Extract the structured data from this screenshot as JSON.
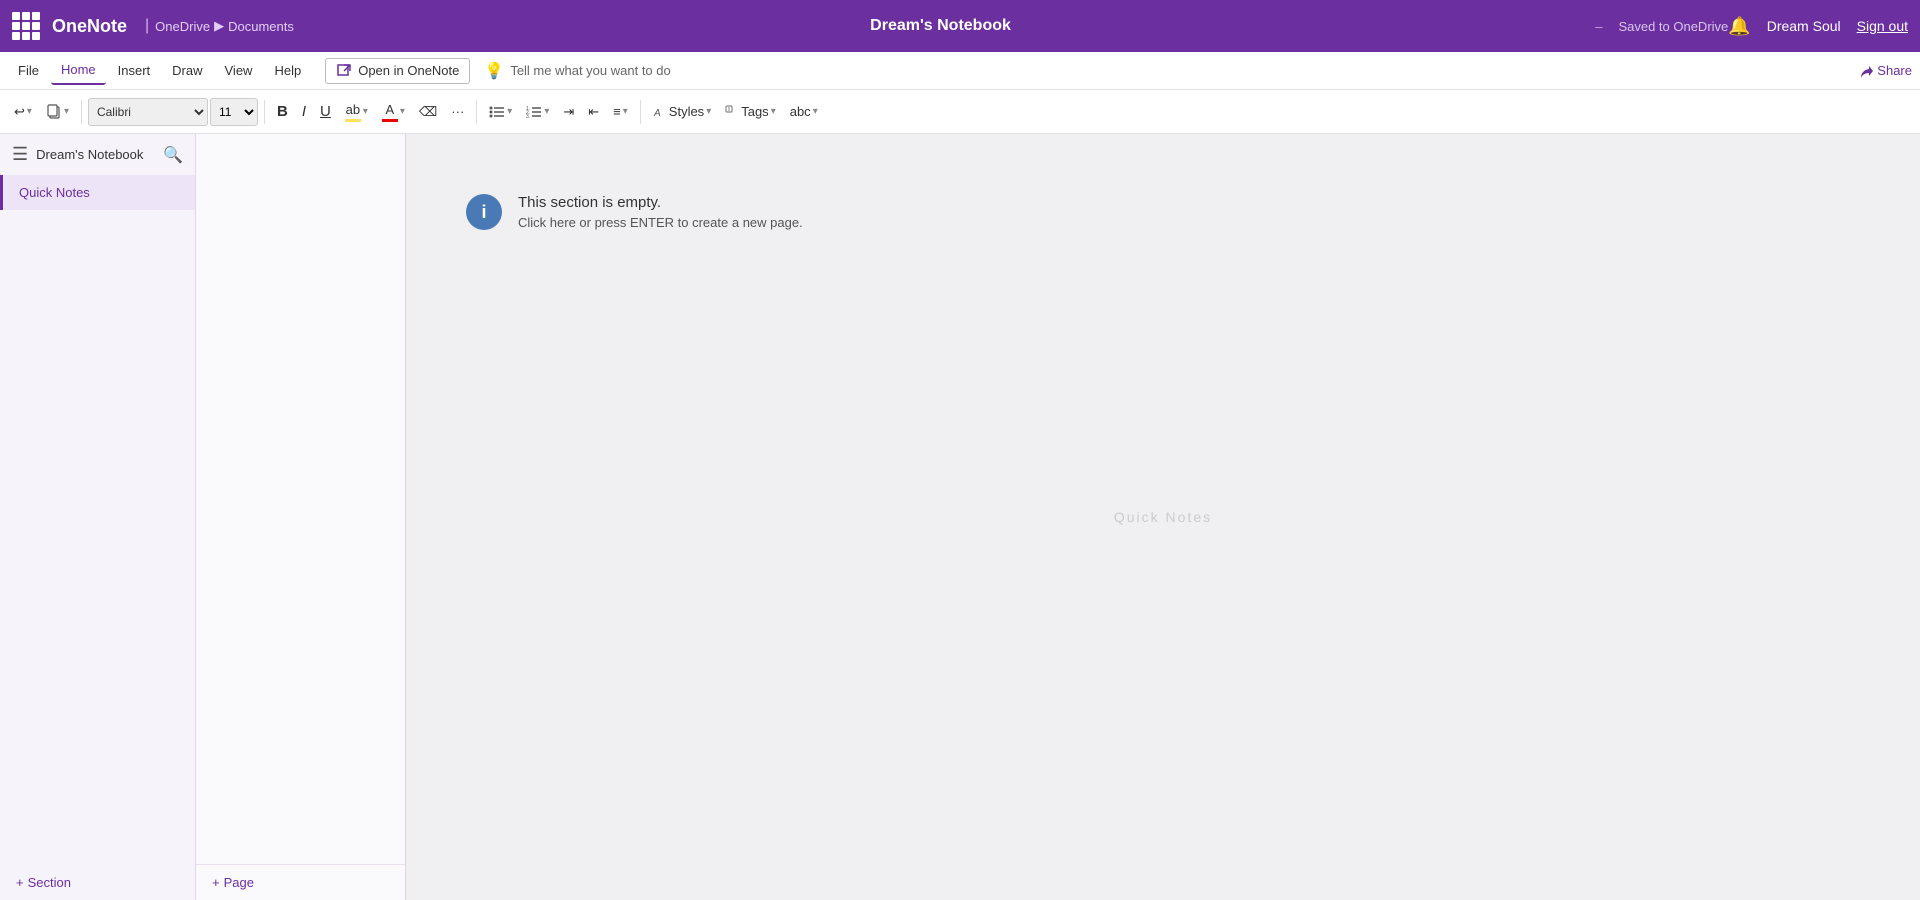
{
  "titlebar": {
    "app_name": "OneNote",
    "breadcrumb_onedrive": "OneDrive",
    "breadcrumb_arrow": "▶",
    "breadcrumb_documents": "Documents",
    "notebook_title": "Dream's Notebook",
    "dash": "–",
    "save_status": "Saved to OneDrive",
    "bell_icon": "🔔",
    "user_name": "Dream Soul",
    "sign_out": "Sign out"
  },
  "menubar": {
    "items": [
      {
        "label": "File",
        "active": false
      },
      {
        "label": "Home",
        "active": true
      },
      {
        "label": "Insert",
        "active": false
      },
      {
        "label": "Draw",
        "active": false
      },
      {
        "label": "View",
        "active": false
      },
      {
        "label": "Help",
        "active": false
      }
    ],
    "open_in_onenote": "Open in OneNote",
    "tell_me": "Tell me what you want to do",
    "share": "Share"
  },
  "toolbar": {
    "undo_label": "↩",
    "redo_label": "↪",
    "font_placeholder": "Calibri",
    "font_size_placeholder": "11",
    "bold": "B",
    "italic": "I",
    "underline": "U",
    "highlight": "ab",
    "font_color": "A",
    "eraser": "⌫",
    "format_more": "···",
    "bullets": "☰",
    "numbered": "☷",
    "indent_more": "→",
    "indent_less": "←",
    "alignment": "≡",
    "styles_label": "Styles",
    "tags_label": "Tags",
    "spell_check": "abc"
  },
  "sidebar": {
    "notebook_label": "Dream's Notebook",
    "search_tooltip": "Search",
    "sections": [
      {
        "label": "Quick Notes",
        "active": true
      }
    ],
    "add_section": "+ Section"
  },
  "pages": {
    "add_page": "+ Page"
  },
  "content": {
    "empty_title": "This section is empty.",
    "empty_subtitle": "Click here or press ENTER to create a new page.",
    "watermark": "Quick Notes"
  }
}
